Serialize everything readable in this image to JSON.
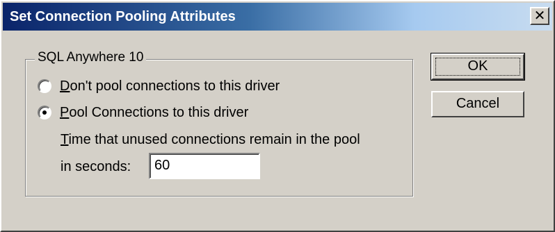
{
  "window": {
    "title": "Set Connection Pooling Attributes",
    "close_glyph": "✕"
  },
  "group": {
    "label": "SQL Anywhere 10"
  },
  "options": [
    {
      "mnemonic": "D",
      "rest": "on't pool connections to this driver",
      "selected": false
    },
    {
      "mnemonic": "P",
      "rest": "ool Connections to this driver",
      "selected": true
    }
  ],
  "timeout": {
    "label_line1_mnemonic": "T",
    "label_line1_rest": "ime that unused connections remain in the pool",
    "label_line2": "in seconds:",
    "value": "60"
  },
  "buttons": {
    "ok": "OK",
    "cancel": "Cancel"
  },
  "colors": {
    "face": "#d4d0c8",
    "title_start": "#0a246a",
    "title_end": "#a6caf0"
  }
}
